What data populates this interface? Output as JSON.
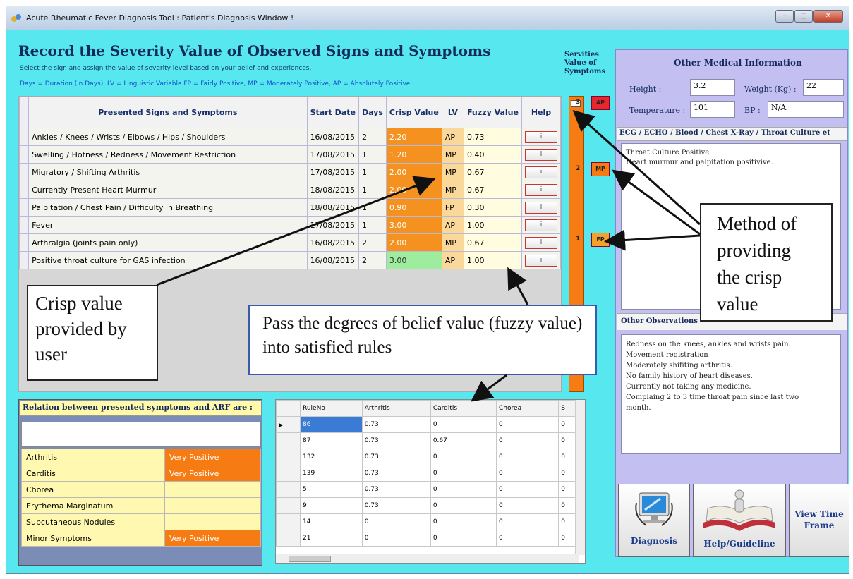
{
  "window": {
    "title": "Acute Rheumatic Fever Diagnosis Tool : Patient's Diagnosis Window !"
  },
  "header": {
    "title": "Record the Severity Value of Observed Signs and Symptoms",
    "subtitle": "Select the sign and assign the value of severity level based on your belief and experiences.",
    "legend": "Days = Duration (in Days),  LV = Linguistic Variable    FP = Fairly Positive, MP = Moderately Positive, AP = Absolutely Positive"
  },
  "symptoms_table": {
    "columns": [
      "Presented Signs and Symptoms",
      "Start Date",
      "Days",
      "Crisp Value",
      "LV",
      "Fuzzy Value",
      "Help"
    ],
    "help_label": "i",
    "rows": [
      {
        "name": "Ankles / Knees / Wrists / Elbows / Hips / Shoulders",
        "date": "16/08/2015",
        "days": "2",
        "crisp": "2.20",
        "lv": "AP",
        "fuzzy": "0.73"
      },
      {
        "name": "Swelling / Hotness / Redness / Movement Restriction",
        "date": "17/08/2015",
        "days": "1",
        "crisp": "1.20",
        "lv": "MP",
        "fuzzy": "0.40"
      },
      {
        "name": "Migratory / Shifting Arthritis",
        "date": "17/08/2015",
        "days": "1",
        "crisp": "2.00",
        "lv": "MP",
        "fuzzy": "0.67"
      },
      {
        "name": "Currently Present Heart Murmur",
        "date": "18/08/2015",
        "days": "1",
        "crisp": "2.00",
        "lv": "MP",
        "fuzzy": "0.67"
      },
      {
        "name": "Palpitation / Chest Pain / Difficulty in Breathing",
        "date": "18/08/2015",
        "days": "1",
        "crisp": "0.90",
        "lv": "FP",
        "fuzzy": "0.30"
      },
      {
        "name": "Fever",
        "date": "17/08/2015",
        "days": "1",
        "crisp": "3.00",
        "lv": "AP",
        "fuzzy": "1.00"
      },
      {
        "name": "Arthralgia (joints pain only)",
        "date": "16/08/2015",
        "days": "2",
        "crisp": "2.00",
        "lv": "MP",
        "fuzzy": "0.67"
      },
      {
        "name": "Positive throat culture for GAS infection",
        "date": "16/08/2015",
        "days": "2",
        "crisp": "3.00",
        "lv": "AP",
        "fuzzy": "1.00"
      }
    ]
  },
  "severity": {
    "title": "Servities Value of Symptoms",
    "levels": [
      {
        "num": "3",
        "label": "AP",
        "color": "#e8262b"
      },
      {
        "num": "2",
        "label": "MP",
        "color": "#f57b12"
      },
      {
        "num": "1",
        "label": "FP",
        "color": "#f5a028"
      }
    ],
    "bar_color": "#f57b12"
  },
  "other_info": {
    "title": "Other Medical Information",
    "height_label": "Height :",
    "height_value": "3.2",
    "weight_label": "Weight (Kg) :",
    "weight_value": "22",
    "temp_label": "Temperature :",
    "temp_value": "101",
    "bp_label": "BP :",
    "bp_value": "N/A",
    "tests_label": "ECG / ECHO  / Blood  / Chest X-Ray / Throat Culture et",
    "tests_line1": "Throat Culture Positive.",
    "tests_line2": "Heart murmur and palpitation positivive.",
    "obs_label": "Other Observations",
    "obs_lines": [
      "Redness on the knees, ankles and wrists pain.",
      "Movement registration",
      "Moderately shifiting arthritis.",
      "No family history of heart diseases.",
      "Currently not taking any medicine.",
      "Complaing 2 to 3 time throat pain since last two",
      "month."
    ]
  },
  "relation": {
    "title": "Relation between presented symptoms and ARF are :",
    "rows": [
      {
        "name": "Arthritis",
        "value": "Very Positive"
      },
      {
        "name": "Carditis",
        "value": "Very Positive"
      },
      {
        "name": "Chorea",
        "value": ""
      },
      {
        "name": "Erythema Marginatum",
        "value": ""
      },
      {
        "name": "Subcutaneous Nodules",
        "value": ""
      },
      {
        "name": "Minor Symptoms",
        "value": "Very Positive"
      }
    ]
  },
  "rules_grid": {
    "columns": [
      "RuleNo",
      "Arthritis",
      "Carditis",
      "Chorea",
      "S"
    ],
    "rows": [
      [
        "86",
        "0.73",
        "0",
        "0",
        "0"
      ],
      [
        "87",
        "0.73",
        "0.67",
        "0",
        "0"
      ],
      [
        "132",
        "0.73",
        "0",
        "0",
        "0"
      ],
      [
        "139",
        "0.73",
        "0",
        "0",
        "0"
      ],
      [
        "5",
        "0.73",
        "0",
        "0",
        "0"
      ],
      [
        "9",
        "0.73",
        "0",
        "0",
        "0"
      ],
      [
        "14",
        "0",
        "0",
        "0",
        "0"
      ],
      [
        "21",
        "0",
        "0",
        "0",
        "0"
      ]
    ]
  },
  "buttons": {
    "diagnosis": "Diagnosis",
    "help": "Help/Guideline",
    "timeframe": "View Time Frame"
  },
  "callouts": {
    "crisp": "Crisp value provided by user",
    "fuzzy": "Pass the degrees of belief value (fuzzy value) into satisfied rules",
    "method": "Method of providing the crisp value"
  }
}
